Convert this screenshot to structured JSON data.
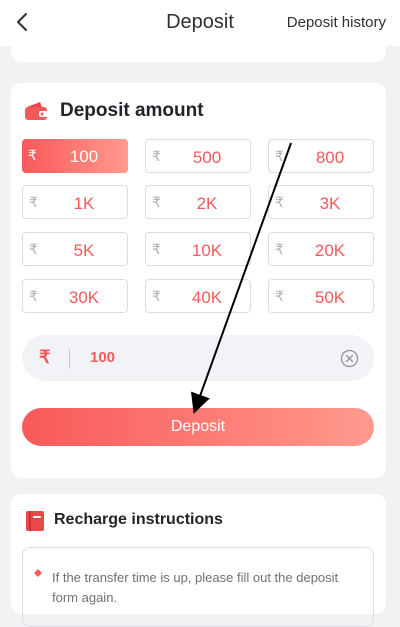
{
  "header": {
    "title": "Deposit",
    "history_label": "Deposit history"
  },
  "amount_section": {
    "title": "Deposit amount",
    "currency_symbol": "₹",
    "options": [
      {
        "label": "100",
        "selected": true
      },
      {
        "label": "500",
        "selected": false
      },
      {
        "label": "800",
        "selected": false
      },
      {
        "label": "1K",
        "selected": false
      },
      {
        "label": "2K",
        "selected": false
      },
      {
        "label": "3K",
        "selected": false
      },
      {
        "label": "5K",
        "selected": false
      },
      {
        "label": "10K",
        "selected": false
      },
      {
        "label": "20K",
        "selected": false
      },
      {
        "label": "30K",
        "selected": false
      },
      {
        "label": "40K",
        "selected": false
      },
      {
        "label": "50K",
        "selected": false
      }
    ],
    "input_value": "100",
    "deposit_button": "Deposit"
  },
  "instructions": {
    "title": "Recharge instructions",
    "items": [
      "If the transfer time is up, please fill out the deposit form again."
    ]
  },
  "icons": {
    "back": "chevron-left-icon",
    "wallet": "wallet-icon",
    "clear": "clear-circle-icon",
    "book": "book-icon",
    "bullet": "diamond-bullet-icon"
  },
  "colors": {
    "accent": "#f45a5a",
    "accent_gradient_start": "#f95959",
    "accent_gradient_end": "#ff9a8e",
    "background": "#f1f2f4",
    "card": "#ffffff"
  }
}
